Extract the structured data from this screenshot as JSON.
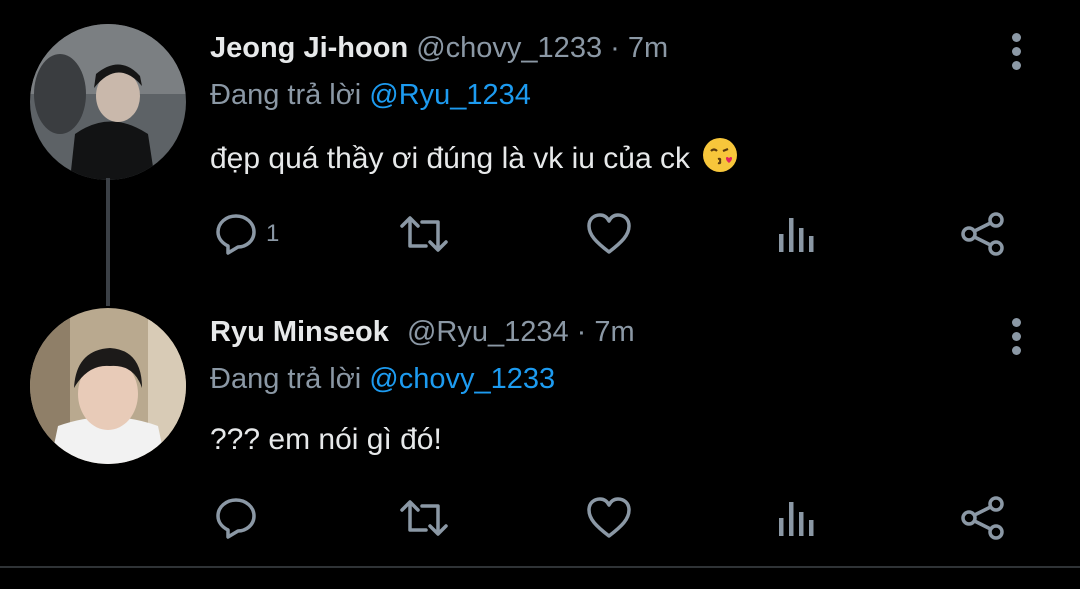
{
  "tweets": [
    {
      "name": "Jeong Ji-hoon",
      "handle": "@chovy_1233",
      "separator": "·",
      "time": "7m",
      "reply_prefix": "Đang trả lời",
      "reply_to": "@Ryu_1234",
      "text": "đẹp quá thầy ơi đúng là vk iu của ck",
      "emoji": "😘",
      "reply_count": "1"
    },
    {
      "name": "Ryu Minseok",
      "handle": "@Ryu_1234",
      "separator": "·",
      "time": "7m",
      "reply_prefix": "Đang trả lời",
      "reply_to": "@chovy_1233",
      "text": "??? em nói gì đó!",
      "reply_count": ""
    }
  ],
  "colors": {
    "background": "#000000",
    "primary_text": "#e7e9ea",
    "secondary_text": "#8b98a5",
    "mention": "#1d9bf0",
    "icon": "#8b98a5",
    "thread_line": "#3b4046"
  },
  "icons": [
    "reply-icon",
    "retweet-icon",
    "like-icon",
    "analytics-icon",
    "share-icon",
    "more-options-icon"
  ]
}
